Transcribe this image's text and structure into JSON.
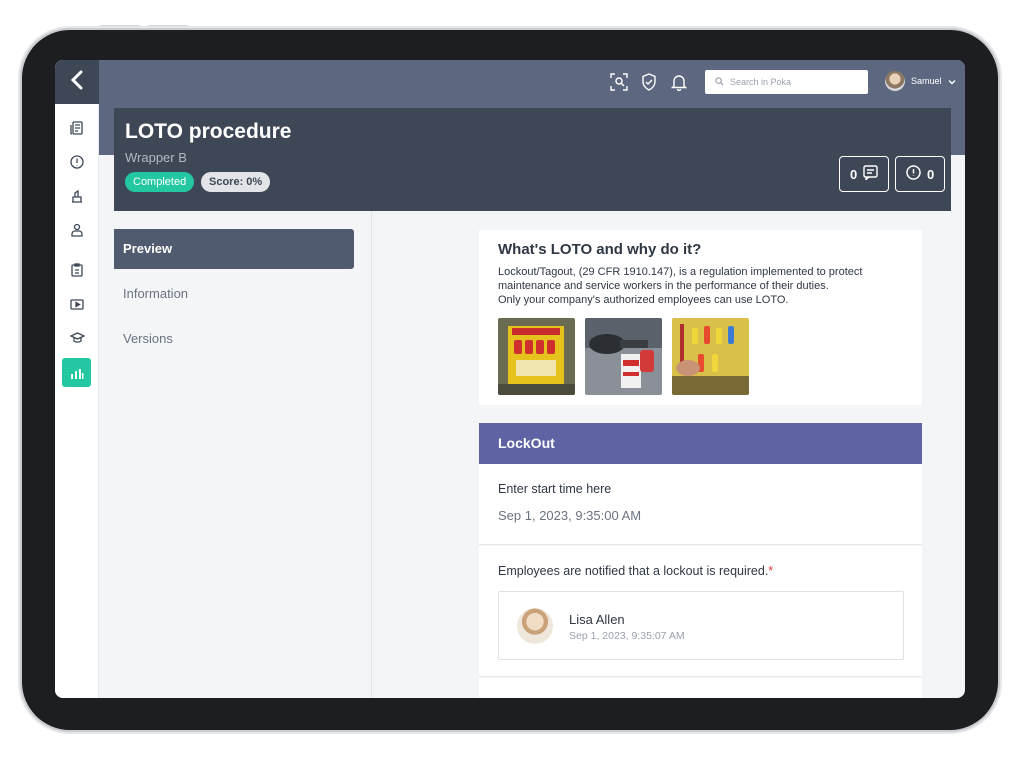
{
  "topbar": {
    "search_placeholder": "Search in Poka",
    "user_name": "Samuel"
  },
  "procedure": {
    "title": "LOTO procedure",
    "subtitle": "Wrapper B",
    "status": "Completed",
    "score": "Score: 0%",
    "comments_count": "0",
    "issues_count": "0"
  },
  "nav": {
    "items": [
      {
        "label": "Preview",
        "active": true
      },
      {
        "label": "Information",
        "active": false
      },
      {
        "label": "Versions",
        "active": false
      }
    ]
  },
  "intro": {
    "title": "What's LOTO and why do it?",
    "lines": [
      "Lockout/Tagout, (29 CFR 1910.147), is a regulation implemented to protect",
      "maintenance and service workers in the performance of their duties.",
      "Only your company's authorized employees can use LOTO."
    ]
  },
  "lockout": {
    "title": "LockOut",
    "start_label": "Enter start time here",
    "start_value": "Sep 1, 2023, 9:35:00 AM",
    "notify_label": "Employees are notified that a lockout is required.",
    "required_mark": "*",
    "signer_name": "Lisa Allen",
    "signer_date": "Sep 1, 2023, 9:35:07 AM"
  },
  "colors": {
    "topbar": "#5d6880",
    "header": "#3e4756",
    "accent": "#23c7a2",
    "section": "#5f63a4"
  },
  "icons": [
    "back-chevron-icon",
    "scan-icon",
    "shield-icon",
    "bell-icon",
    "search-icon",
    "chevron-down-icon",
    "comment-icon",
    "alert-icon"
  ]
}
